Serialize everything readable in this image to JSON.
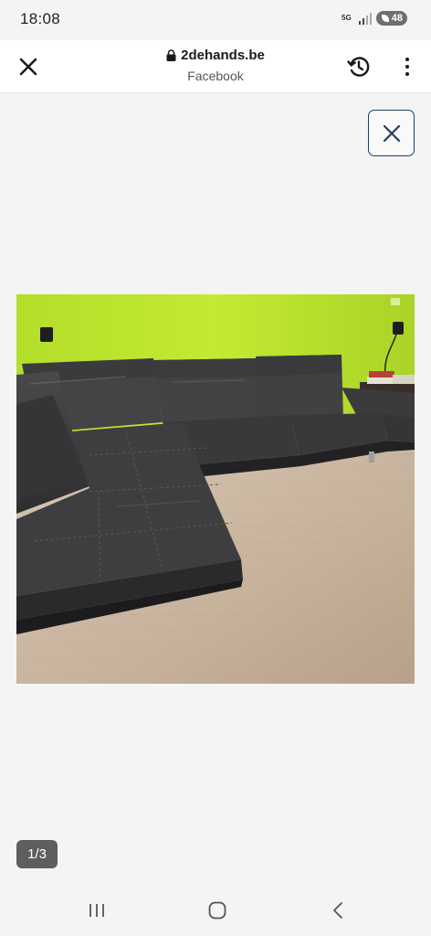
{
  "status_bar": {
    "time": "18:08",
    "network": "5G",
    "battery": "48",
    "icons": [
      "5g-icon",
      "signal-icon",
      "battery-saver-icon"
    ]
  },
  "toolbar": {
    "domain": "2dehands.be",
    "subtitle": "Facebook",
    "icons": [
      "close-icon",
      "lock-icon",
      "history-icon",
      "more-vert-icon"
    ]
  },
  "viewer": {
    "counter": "1/3",
    "image_alt": "Dark grey leather corner sofa against a lime green wall on a light wooden floor",
    "icons": [
      "close-icon"
    ]
  },
  "navbar": {
    "icons": [
      "recent-apps-icon",
      "home-icon",
      "back-icon"
    ]
  },
  "colors": {
    "accent": "#1f3f63",
    "wall": "#b6e12a",
    "sofa": "#3b3b3d",
    "floor": "#cbb8a4",
    "counter_bg": "#5e5e5e"
  }
}
